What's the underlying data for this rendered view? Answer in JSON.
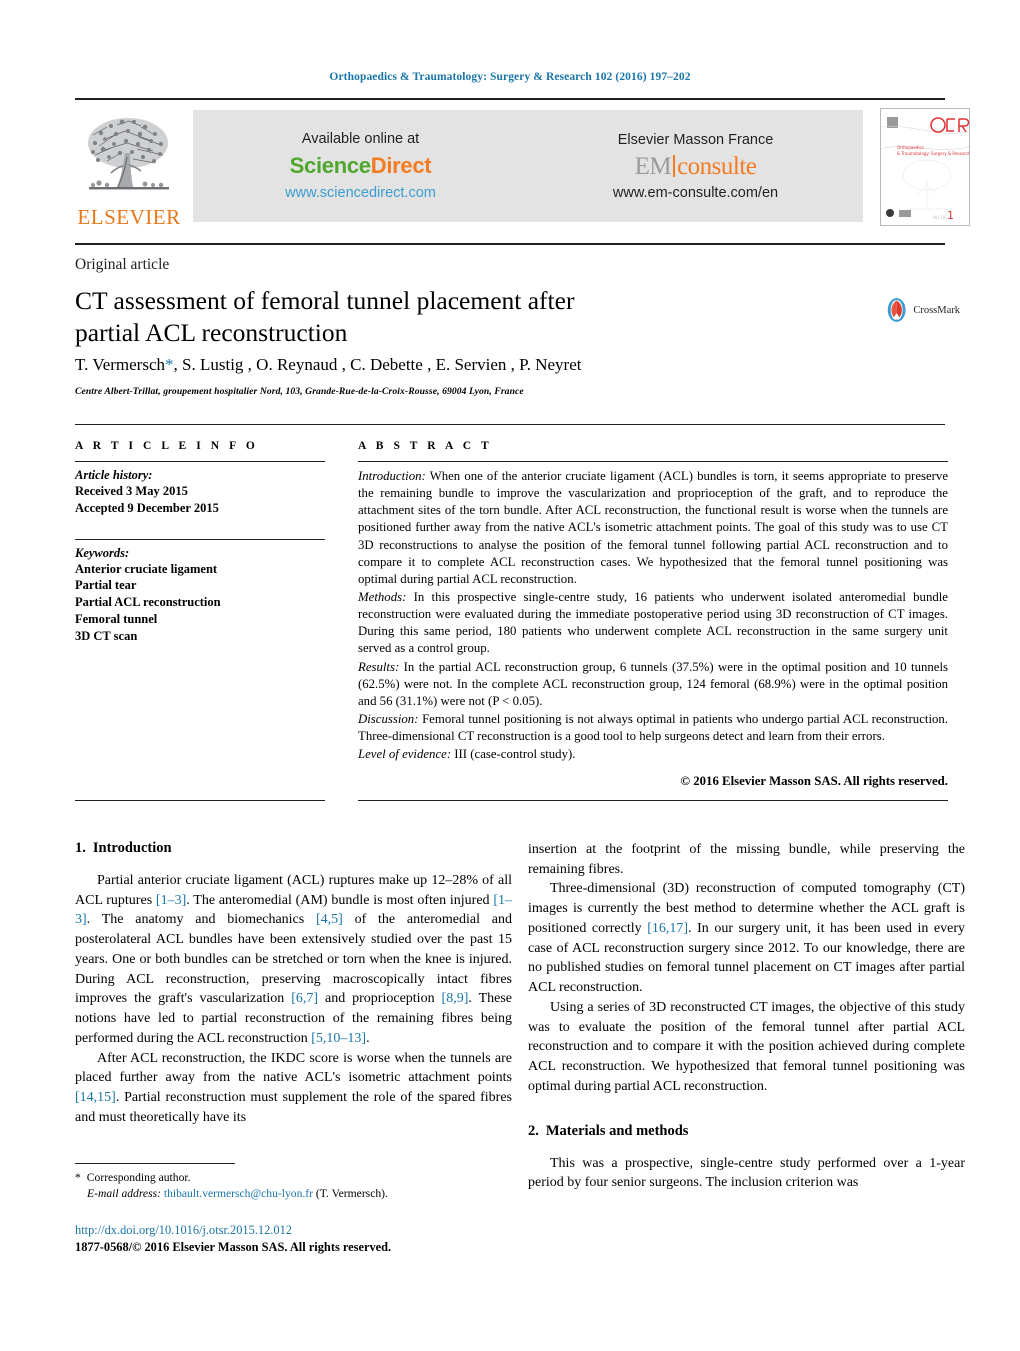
{
  "running_head": "Orthopaedics & Traumatology: Surgery & Research 102 (2016) 197–202",
  "masthead": {
    "publisher_logo_label": "ELSEVIER",
    "available_label": "Available online at",
    "sciencedirect_science": "Science",
    "sciencedirect_direct": "Direct",
    "sciencedirect_url": "www.sciencedirect.com",
    "masson_label": "Elsevier Masson France",
    "em_prefix": "EM",
    "em_suffix": "consulte",
    "em_url": "www.em-consulte.com/en",
    "cover_journal_initials": "OTSR",
    "cover_caption": "Orthopaedics & Traumatology: Surgery & Research",
    "cover_issue_number": "1"
  },
  "article": {
    "kind": "Original article",
    "title_line1": "CT assessment of femoral tunnel placement after",
    "title_line2": "partial ACL reconstruction",
    "authors": "T. Vermersch",
    "author_star": "*",
    "authors_rest": ", S. Lustig , O. Reynaud , C. Debette , E. Servien , P. Neyret",
    "affiliation": "Centre Albert-Trillat, groupement hospitalier Nord, 103, Grande-Rue-de-la-Croix-Rousse, 69004 Lyon, France",
    "crossmark_label": "CrossMark"
  },
  "info": {
    "heading": "A R T I C L E   I N F O",
    "history_label": "Article history:",
    "received": "Received 3 May 2015",
    "accepted": "Accepted 9 December 2015",
    "keywords_label": "Keywords:",
    "keywords": [
      "Anterior cruciate ligament",
      "Partial tear",
      "Partial ACL reconstruction",
      "Femoral tunnel",
      "3D CT scan"
    ]
  },
  "abstract": {
    "heading": "A B S T R A C T",
    "introduction_label": "Introduction:",
    "introduction_text": " When one of the anterior cruciate ligament (ACL) bundles is torn, it seems appropriate to preserve the remaining bundle to improve the vascularization and proprioception of the graft, and to reproduce the attachment sites of the torn bundle. After ACL reconstruction, the functional result is worse when the tunnels are positioned further away from the native ACL's isometric attachment points. The goal of this study was to use CT 3D reconstructions to analyse the position of the femoral tunnel following partial ACL reconstruction and to compare it to complete ACL reconstruction cases. We hypothesized that the femoral tunnel positioning was optimal during partial ACL reconstruction.",
    "methods_label": "Methods:",
    "methods_text": " In this prospective single-centre study, 16 patients who underwent isolated anteromedial bundle reconstruction were evaluated during the immediate postoperative period using 3D reconstruction of CT images. During this same period, 180 patients who underwent complete ACL reconstruction in the same surgery unit served as a control group.",
    "results_label": "Results:",
    "results_text": " In the partial ACL reconstruction group, 6 tunnels (37.5%) were in the optimal position and 10 tunnels (62.5%) were not. In the complete ACL reconstruction group, 124 femoral (68.9%) were in the optimal position and 56 (31.1%) were not (P < 0.05).",
    "discussion_label": "Discussion:",
    "discussion_text": " Femoral tunnel positioning is not always optimal in patients who undergo partial ACL reconstruction. Three-dimensional CT reconstruction is a good tool to help surgeons detect and learn from their errors.",
    "evidence_label": "Level of evidence:",
    "evidence_text": " III (case-control study).",
    "copyright": "© 2016 Elsevier Masson SAS. All rights reserved."
  },
  "body": {
    "section1_num": "1.",
    "section1_title": "Introduction",
    "section2_num": "2.",
    "section2_title": "Materials and methods",
    "left_p1_a": "Partial anterior cruciate ligament (ACL) ruptures make up 12–28% of all ACL ruptures ",
    "left_p1_r1": "[1–3]",
    "left_p1_b": ". The anteromedial (AM) bundle is most often injured ",
    "left_p1_r2": "[1–3]",
    "left_p1_c": ". The anatomy and biomechanics ",
    "left_p1_r3": "[4,5]",
    "left_p1_d": " of the anteromedial and posterolateral ACL bundles have been extensively studied over the past 15 years. One or both bundles can be stretched or torn when the knee is injured. During ACL reconstruction, preserving macroscopically intact fibres improves the graft's vascularization ",
    "left_p1_r4": "[6,7]",
    "left_p1_e": " and proprioception ",
    "left_p1_r5": "[8,9]",
    "left_p1_f": ". These notions have led to partial reconstruction of the remaining fibres being performed during the ACL reconstruction ",
    "left_p1_r6": "[5,10–13]",
    "left_p1_g": ".",
    "left_p2_a": "After ACL reconstruction, the IKDC score is worse when the tunnels are placed further away from the native ACL's isometric attachment points ",
    "left_p2_r1": "[14,15]",
    "left_p2_b": ". Partial reconstruction must supplement the role of the spared fibres and must theoretically have its",
    "right_p1": "insertion at the footprint of the missing bundle, while preserving the remaining fibres.",
    "right_p2_a": "Three-dimensional (3D) reconstruction of computed tomography (CT) images is currently the best method to determine whether the ACL graft is positioned correctly ",
    "right_p2_r1": "[16,17]",
    "right_p2_b": ". In our surgery unit, it has been used in every case of ACL reconstruction surgery since 2012. To our knowledge, there are no published studies on femoral tunnel placement on CT images after partial ACL reconstruction.",
    "right_p3": "Using a series of 3D reconstructed CT images, the objective of this study was to evaluate the position of the femoral tunnel after partial ACL reconstruction and to compare it with the position achieved during complete ACL reconstruction. We hypothesized that femoral tunnel positioning was optimal during partial ACL reconstruction.",
    "right_p4": "This was a prospective, single-centre study performed over a 1-year period by four senior surgeons. The inclusion criterion was"
  },
  "footnotes": {
    "star": "*",
    "corresponding": "Corresponding author.",
    "email_label": "E-mail address:",
    "email": "thibault.vermersch@chu-lyon.fr",
    "email_owner": " (T. Vermersch).",
    "doi": "http://dx.doi.org/10.1016/j.otsr.2015.12.012",
    "issn_copyright": "1877-0568/© 2016 Elsevier Masson SAS. All rights reserved."
  },
  "colors": {
    "link": "#1a75a7",
    "elsevier_orange": "#e77817",
    "sciencedirect_green": "#4fa72e",
    "sciencedirect_orange": "#f47b20",
    "banner_bg": "#e3e3e3"
  }
}
